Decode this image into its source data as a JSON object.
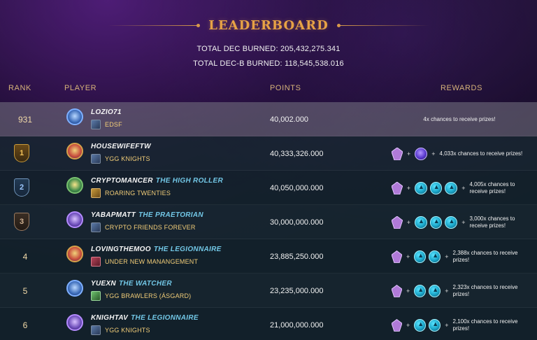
{
  "header": {
    "title": "LEADERBOARD",
    "total_dec_burned": "TOTAL DEC BURNED: 205,432,275.341",
    "total_dec_b_burned": "TOTAL DEC-B BURNED: 118,545,538.016"
  },
  "columns": {
    "rank": "RANK",
    "player": "PLAYER",
    "points": "POINTS",
    "rewards": "REWARDS"
  },
  "rows": [
    {
      "rank": "931",
      "name": "LOZIO71",
      "title": "",
      "guild": "EDSF",
      "points": "40,002.000",
      "rewards": "4x chances to receive prizes!"
    },
    {
      "rank": "1",
      "name": "HOUSEWIFEFTW",
      "title": "",
      "guild": "YGG KNIGHTS",
      "points": "40,333,326.000",
      "rewards": "4,033x chances to receive prizes!"
    },
    {
      "rank": "2",
      "name": "CRYPTOMANCER",
      "title": "THE HIGH ROLLER",
      "guild": "ROARING TWENTIES",
      "points": "40,050,000.000",
      "rewards": "4,005x chances to receive prizes!"
    },
    {
      "rank": "3",
      "name": "YABAPMATT",
      "title": "THE PRAETORIAN",
      "guild": "CRYPTO FRIENDS FOREVER",
      "points": "30,000,000.000",
      "rewards": "3,000x chances to receive prizes!"
    },
    {
      "rank": "4",
      "name": "LOVINGTHEMOO",
      "title": "THE LEGIONNAIRE",
      "guild": "UNDER NEW MANANGEMENT",
      "points": "23,885,250.000",
      "rewards": "2,388x chances to receive prizes!"
    },
    {
      "rank": "5",
      "name": "YUEXN",
      "title": "THE WATCHER",
      "guild": "YGG BRAWLERS (ÁSGARD)",
      "points": "23,235,000.000",
      "rewards": "2,323x chances to receive prizes!"
    },
    {
      "rank": "6",
      "name": "KNIGHTAV",
      "title": "THE LEGIONNAIRE",
      "guild": "YGG KNIGHTS",
      "points": "21,000,000.000",
      "rewards": "2,100x chances to receive prizes!"
    }
  ],
  "icons": {
    "rank_badge": "rank-badge-icon",
    "avatar": "player-avatar-icon",
    "guild": "guild-crest-icon",
    "reward_shard": "shard-reward-icon",
    "reward_orb": "orb-reward-icon",
    "reward_coin": "coin-reward-icon"
  },
  "colors": {
    "title": "#e7a245",
    "column_header": "#d6b27a",
    "player_title": "#72c7e6",
    "guild_name": "#f2cd78"
  }
}
